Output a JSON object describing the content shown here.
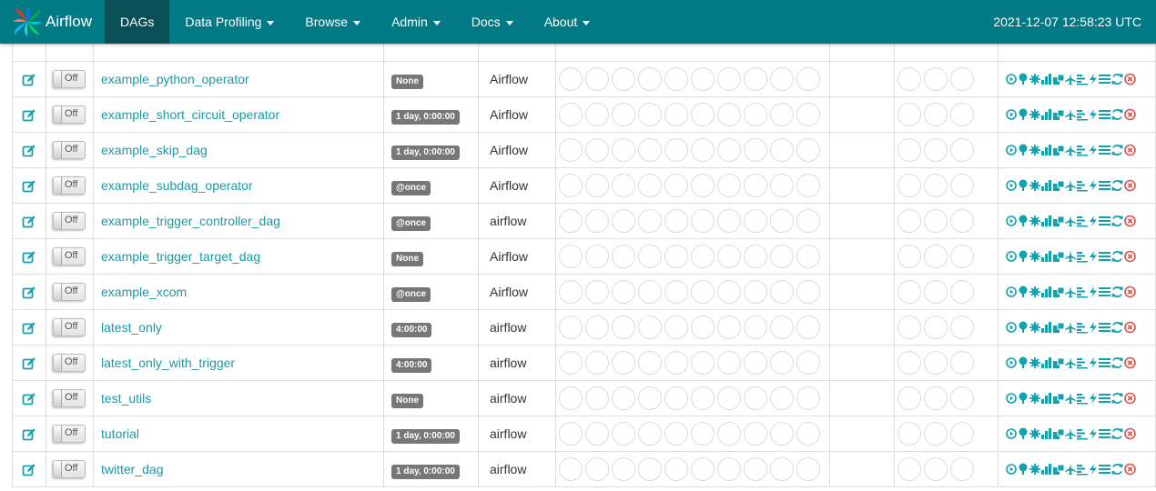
{
  "navbar": {
    "brand": "Airflow",
    "items": [
      {
        "label": "DAGs",
        "active": true,
        "dropdown": false
      },
      {
        "label": "Data Profiling",
        "active": false,
        "dropdown": true
      },
      {
        "label": "Browse",
        "active": false,
        "dropdown": true
      },
      {
        "label": "Admin",
        "active": false,
        "dropdown": true
      },
      {
        "label": "Docs",
        "active": false,
        "dropdown": true
      },
      {
        "label": "About",
        "active": false,
        "dropdown": true
      }
    ],
    "clock": "2021-12-07 12:58:23 UTC"
  },
  "toggle_label": "Off",
  "rows": [
    {
      "dag": "example_python_operator",
      "schedule": "None",
      "owner": "Airflow"
    },
    {
      "dag": "example_short_circuit_operator",
      "schedule": "1 day, 0:00:00",
      "owner": "Airflow"
    },
    {
      "dag": "example_skip_dag",
      "schedule": "1 day, 0:00:00",
      "owner": "Airflow"
    },
    {
      "dag": "example_subdag_operator",
      "schedule": "@once",
      "owner": "Airflow"
    },
    {
      "dag": "example_trigger_controller_dag",
      "schedule": "@once",
      "owner": "airflow"
    },
    {
      "dag": "example_trigger_target_dag",
      "schedule": "None",
      "owner": "Airflow"
    },
    {
      "dag": "example_xcom",
      "schedule": "@once",
      "owner": "Airflow"
    },
    {
      "dag": "latest_only",
      "schedule": "4:00:00",
      "owner": "airflow"
    },
    {
      "dag": "latest_only_with_trigger",
      "schedule": "4:00:00",
      "owner": "airflow"
    },
    {
      "dag": "test_utils",
      "schedule": "None",
      "owner": "airflow"
    },
    {
      "dag": "tutorial",
      "schedule": "1 day, 0:00:00",
      "owner": "airflow"
    },
    {
      "dag": "twitter_dag",
      "schedule": "1 day, 0:00:00",
      "owner": "airflow"
    }
  ],
  "icons": {
    "edit": "edit-icon",
    "links": [
      "trigger-dag-icon",
      "tree-view-icon",
      "graph-view-icon",
      "tries-chart-icon",
      "duration-chart-icon",
      "landing-times-icon",
      "gantt-icon",
      "code-view-icon",
      "logs-icon",
      "refresh-icon",
      "delete-icon"
    ]
  },
  "colors": {
    "navbar": "#017a86",
    "navbar_active": "#0a4f55",
    "link": "#1a9aa6",
    "schedule_label": "#777777",
    "delete": "#d9534f"
  }
}
